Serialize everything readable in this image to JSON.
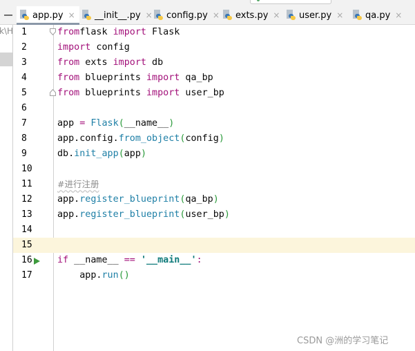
{
  "left_panel": {
    "path_fragment": "k\\H"
  },
  "tabs": [
    {
      "label": "app.py",
      "icon": "python-file-icon",
      "active": true,
      "close": "×"
    },
    {
      "label": "__init__.py",
      "icon": "python-file-icon",
      "active": false,
      "close": "×"
    },
    {
      "label": "config.py",
      "icon": "python-file-icon",
      "active": false,
      "close": "×"
    },
    {
      "label": "exts.py",
      "icon": "python-file-icon",
      "active": false,
      "close": "×"
    },
    {
      "label": "user.py",
      "icon": "python-file-icon",
      "active": false,
      "close": "×"
    },
    {
      "label": "qa.py",
      "icon": "python-file-icon",
      "active": false,
      "close": "×"
    }
  ],
  "editor": {
    "current_line": 15,
    "run_line": 16,
    "lines": [
      {
        "n": "1",
        "tokens": [
          [
            "kw",
            "from"
          ],
          [
            "",
            "flask "
          ],
          [
            "kw",
            "import"
          ],
          [
            "",
            " Flask"
          ]
        ]
      },
      {
        "n": "2",
        "tokens": [
          [
            "kw",
            "import"
          ],
          [
            "",
            " config"
          ]
        ]
      },
      {
        "n": "3",
        "tokens": [
          [
            "kw",
            "from"
          ],
          [
            "",
            " exts "
          ],
          [
            "kw",
            "import"
          ],
          [
            "",
            " db"
          ]
        ]
      },
      {
        "n": "4",
        "tokens": [
          [
            "kw",
            "from"
          ],
          [
            "",
            " blueprints "
          ],
          [
            "kw",
            "import"
          ],
          [
            "",
            " qa_bp"
          ]
        ]
      },
      {
        "n": "5",
        "tokens": [
          [
            "kw",
            "from"
          ],
          [
            "",
            " blueprints "
          ],
          [
            "kw",
            "import"
          ],
          [
            "",
            " user_bp"
          ]
        ]
      },
      {
        "n": "6",
        "tokens": []
      },
      {
        "n": "7",
        "tokens": [
          [
            "",
            "app "
          ],
          [
            "kw",
            "="
          ],
          [
            "",
            " "
          ],
          [
            "cls",
            "Flask"
          ],
          [
            "paren",
            "("
          ],
          [
            "",
            "__name__"
          ],
          [
            "paren",
            ")"
          ]
        ]
      },
      {
        "n": "8",
        "tokens": [
          [
            "",
            "app.config."
          ],
          [
            "fn",
            "from_object"
          ],
          [
            "paren",
            "("
          ],
          [
            "",
            "config"
          ],
          [
            "paren",
            ")"
          ]
        ]
      },
      {
        "n": "9",
        "tokens": [
          [
            "",
            "db."
          ],
          [
            "fn",
            "init_app"
          ],
          [
            "paren",
            "("
          ],
          [
            "",
            "app"
          ],
          [
            "paren",
            ")"
          ]
        ]
      },
      {
        "n": "10",
        "tokens": []
      },
      {
        "n": "11",
        "tokens": [
          [
            "cmt",
            "#进行注册"
          ]
        ]
      },
      {
        "n": "12",
        "tokens": [
          [
            "",
            "app."
          ],
          [
            "fn",
            "register_blueprint"
          ],
          [
            "paren",
            "("
          ],
          [
            "",
            "qa_bp"
          ],
          [
            "paren",
            ")"
          ]
        ]
      },
      {
        "n": "13",
        "tokens": [
          [
            "",
            "app."
          ],
          [
            "fn",
            "register_blueprint"
          ],
          [
            "paren",
            "("
          ],
          [
            "",
            "user_bp"
          ],
          [
            "paren",
            ")"
          ]
        ]
      },
      {
        "n": "14",
        "tokens": []
      },
      {
        "n": "15",
        "tokens": []
      },
      {
        "n": "16",
        "tokens": [
          [
            "kw",
            "if"
          ],
          [
            "",
            " __name__ "
          ],
          [
            "kw",
            "=="
          ],
          [
            "",
            " "
          ],
          [
            "str",
            "'__main__'"
          ],
          [
            "kw",
            ":"
          ]
        ]
      },
      {
        "n": "17",
        "tokens": [
          [
            "",
            "    app."
          ],
          [
            "fn",
            "run"
          ],
          [
            "paren",
            "()"
          ]
        ]
      }
    ]
  },
  "watermark": "CSDN @洲的学习笔记"
}
